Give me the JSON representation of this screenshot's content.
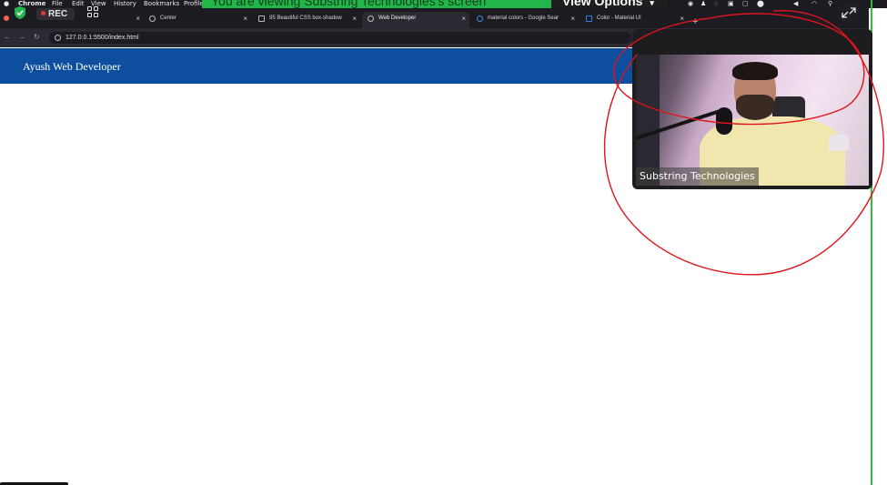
{
  "menubar": {
    "items": [
      "Chrome",
      "File",
      "Edit",
      "View",
      "History",
      "Bookmarks",
      "Profile"
    ]
  },
  "zoom": {
    "share_banner": "You are viewing Substring Technologies's screen",
    "view_options": "View Options",
    "rec_label": "REC",
    "participant_name": "Substring Technologies"
  },
  "tabs": [
    {
      "label": "",
      "active": false
    },
    {
      "label": "Center",
      "active": false
    },
    {
      "label": "95 Beautiful CSS box-shadow",
      "active": false
    },
    {
      "label": "Web Developer",
      "active": true
    },
    {
      "label": "material colors - Google Sear",
      "active": false
    },
    {
      "label": "Color - Material UI",
      "active": false
    }
  ],
  "new_tab": "+",
  "tab_close": "×",
  "address": {
    "url": "127.0.0.1:5500/index.html"
  },
  "page": {
    "brand": "Ayush Web Developer"
  },
  "colors": {
    "header_blue": "#0d4f9e",
    "zoom_green": "#22b54a",
    "annotation_red": "#e0141c"
  }
}
